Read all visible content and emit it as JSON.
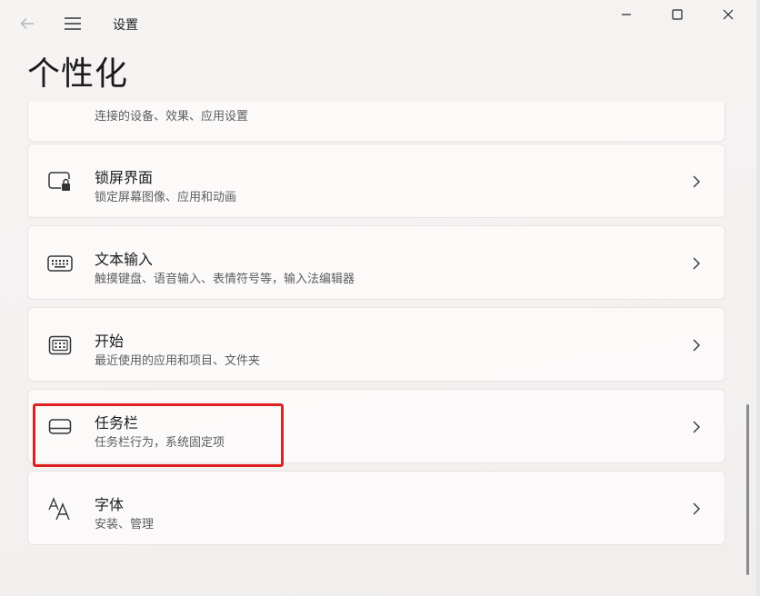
{
  "app": {
    "title": "设置",
    "page_title": "个性化"
  },
  "titlebar": {
    "back_icon": "back-arrow-icon",
    "menu_icon": "hamburger-menu-icon",
    "minimize_icon": "minimize-icon",
    "maximize_icon": "maximize-icon",
    "close_icon": "close-icon"
  },
  "items": [
    {
      "title": "",
      "subtitle": "连接的设备、效果、应用设置",
      "icon": "dynamic-lighting-icon"
    },
    {
      "title": "锁屏界面",
      "subtitle": "锁定屏幕图像、应用和动画",
      "icon": "lock-screen-icon"
    },
    {
      "title": "文本输入",
      "subtitle": "触摸键盘、语音输入、表情符号等，输入法编辑器",
      "icon": "keyboard-icon"
    },
    {
      "title": "开始",
      "subtitle": "最近使用的应用和项目、文件夹",
      "icon": "start-menu-icon"
    },
    {
      "title": "任务栏",
      "subtitle": "任务栏行为，系统固定项",
      "icon": "taskbar-icon"
    },
    {
      "title": "字体",
      "subtitle": "安装、管理",
      "icon": "fonts-icon"
    }
  ],
  "colors": {
    "highlight": "#e02020",
    "background": "#f4f1f1",
    "card": "#fcfafa"
  }
}
